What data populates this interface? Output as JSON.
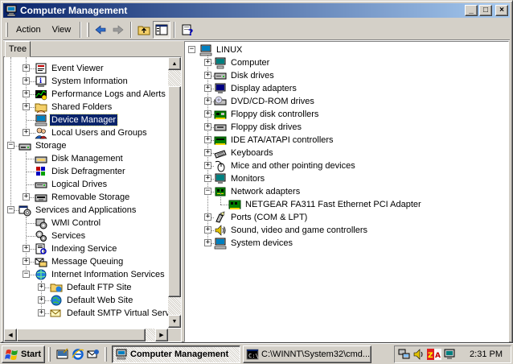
{
  "window": {
    "title": "Computer Management",
    "buttons": {
      "minimize": "_",
      "maximize": "□",
      "close": "×"
    }
  },
  "menu": {
    "action": "Action",
    "view": "View"
  },
  "tabs": {
    "tree": "Tree"
  },
  "left_tree": [
    {
      "label": "Event Viewer",
      "icon": "event-viewer-icon",
      "expander": "+"
    },
    {
      "label": "System Information",
      "icon": "system-info-icon",
      "expander": "+"
    },
    {
      "label": "Performance Logs and Alerts",
      "icon": "performance-icon",
      "expander": "+"
    },
    {
      "label": "Shared Folders",
      "icon": "shared-folders-icon",
      "expander": "+"
    },
    {
      "label": "Device Manager",
      "icon": "device-manager-icon",
      "expander": "",
      "selected": true
    },
    {
      "label": "Local Users and Groups",
      "icon": "users-icon",
      "expander": "+"
    },
    {
      "label": "Storage",
      "icon": "storage-icon",
      "expander": "−"
    },
    {
      "label": "Disk Management",
      "icon": "disk-management-icon",
      "expander": ""
    },
    {
      "label": "Disk Defragmenter",
      "icon": "defrag-icon",
      "expander": ""
    },
    {
      "label": "Logical Drives",
      "icon": "logical-drive-icon",
      "expander": ""
    },
    {
      "label": "Removable Storage",
      "icon": "removable-storage-icon",
      "expander": "+"
    },
    {
      "label": "Services and Applications",
      "icon": "services-apps-icon",
      "expander": "−"
    },
    {
      "label": "WMI Control",
      "icon": "wmi-icon",
      "expander": ""
    },
    {
      "label": "Services",
      "icon": "services-icon",
      "expander": ""
    },
    {
      "label": "Indexing Service",
      "icon": "indexing-icon",
      "expander": "+"
    },
    {
      "label": "Message Queuing",
      "icon": "message-queuing-icon",
      "expander": "+"
    },
    {
      "label": "Internet Information Services",
      "icon": "iis-icon",
      "expander": "−"
    },
    {
      "label": "Default FTP Site",
      "icon": "ftp-site-icon",
      "expander": "+"
    },
    {
      "label": "Default Web Site",
      "icon": "web-site-icon",
      "expander": "+"
    },
    {
      "label": "Default SMTP Virtual Server",
      "icon": "smtp-icon",
      "expander": "+"
    }
  ],
  "device_tree": {
    "root": "LINUX",
    "items": [
      {
        "label": "Computer",
        "icon": "computer-icon",
        "expander": "+"
      },
      {
        "label": "Disk drives",
        "icon": "disk-drive-icon",
        "expander": "+"
      },
      {
        "label": "Display adapters",
        "icon": "display-adapter-icon",
        "expander": "+"
      },
      {
        "label": "DVD/CD-ROM drives",
        "icon": "cdrom-icon",
        "expander": "+"
      },
      {
        "label": "Floppy disk controllers",
        "icon": "floppy-controller-icon",
        "expander": "+"
      },
      {
        "label": "Floppy disk drives",
        "icon": "floppy-drive-icon",
        "expander": "+"
      },
      {
        "label": "IDE ATA/ATAPI controllers",
        "icon": "ide-controller-icon",
        "expander": "+"
      },
      {
        "label": "Keyboards",
        "icon": "keyboard-icon",
        "expander": "+"
      },
      {
        "label": "Mice and other pointing devices",
        "icon": "mouse-icon",
        "expander": "+"
      },
      {
        "label": "Monitors",
        "icon": "monitor-icon",
        "expander": "+"
      },
      {
        "label": "Network adapters",
        "icon": "network-adapter-icon",
        "expander": "−"
      },
      {
        "label": "NETGEAR FA311 Fast Ethernet PCI Adapter",
        "icon": "network-card-icon",
        "expander": ""
      },
      {
        "label": "Ports (COM & LPT)",
        "icon": "ports-icon",
        "expander": "+"
      },
      {
        "label": "Sound, video and game controllers",
        "icon": "sound-icon",
        "expander": "+"
      },
      {
        "label": "System devices",
        "icon": "system-devices-icon",
        "expander": "+"
      }
    ]
  },
  "taskbar": {
    "start": "Start",
    "tasks": [
      {
        "label": "Computer Management",
        "active": true
      },
      {
        "label": "C:\\WINNT\\System32\\cmd...",
        "active": false
      }
    ],
    "clock": "2:31 PM"
  },
  "colors": {
    "title_start": "#0a246a",
    "title_end": "#a6caf0",
    "selection": "#0a246a",
    "face": "#d4d0c8"
  }
}
